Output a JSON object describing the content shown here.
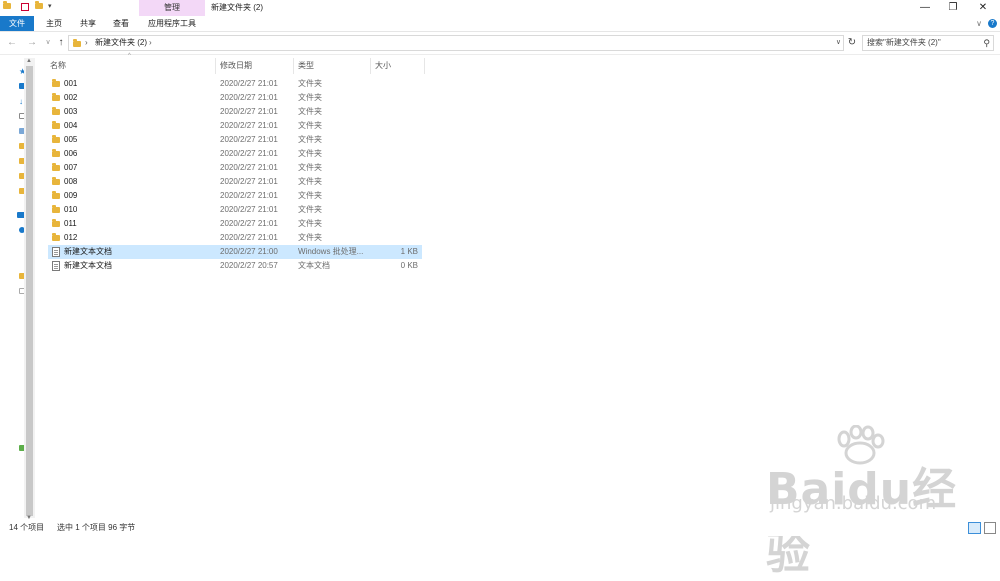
{
  "titlebar": {
    "manage_tab": "管理",
    "window_title": "新建文件夹 (2)",
    "minimize": "—",
    "maximize": "❐",
    "close": "✕"
  },
  "ribbon": {
    "tabs": [
      "文件",
      "主页",
      "共享",
      "查看",
      "应用程序工具"
    ],
    "collapse_glyph": "∨",
    "help_glyph": "?"
  },
  "address": {
    "path": "新建文件夹 (2)",
    "search_placeholder": "搜索\"新建文件夹 (2)\""
  },
  "columns": {
    "name": "名称",
    "date": "修改日期",
    "type": "类型",
    "size": "大小"
  },
  "files": [
    {
      "name": "001",
      "date": "2020/2/27 21:01",
      "type": "文件夹",
      "size": "",
      "kind": "folder"
    },
    {
      "name": "002",
      "date": "2020/2/27 21:01",
      "type": "文件夹",
      "size": "",
      "kind": "folder"
    },
    {
      "name": "003",
      "date": "2020/2/27 21:01",
      "type": "文件夹",
      "size": "",
      "kind": "folder"
    },
    {
      "name": "004",
      "date": "2020/2/27 21:01",
      "type": "文件夹",
      "size": "",
      "kind": "folder"
    },
    {
      "name": "005",
      "date": "2020/2/27 21:01",
      "type": "文件夹",
      "size": "",
      "kind": "folder"
    },
    {
      "name": "006",
      "date": "2020/2/27 21:01",
      "type": "文件夹",
      "size": "",
      "kind": "folder"
    },
    {
      "name": "007",
      "date": "2020/2/27 21:01",
      "type": "文件夹",
      "size": "",
      "kind": "folder"
    },
    {
      "name": "008",
      "date": "2020/2/27 21:01",
      "type": "文件夹",
      "size": "",
      "kind": "folder"
    },
    {
      "name": "009",
      "date": "2020/2/27 21:01",
      "type": "文件夹",
      "size": "",
      "kind": "folder"
    },
    {
      "name": "010",
      "date": "2020/2/27 21:01",
      "type": "文件夹",
      "size": "",
      "kind": "folder"
    },
    {
      "name": "011",
      "date": "2020/2/27 21:01",
      "type": "文件夹",
      "size": "",
      "kind": "folder"
    },
    {
      "name": "012",
      "date": "2020/2/27 21:01",
      "type": "文件夹",
      "size": "",
      "kind": "folder"
    },
    {
      "name": "新建文本文档",
      "date": "2020/2/27 21:00",
      "type": "Windows 批处理...",
      "size": "1 KB",
      "kind": "batch",
      "selected": true
    },
    {
      "name": "新建文本文档",
      "date": "2020/2/27 20:57",
      "type": "文本文档",
      "size": "0 KB",
      "kind": "text"
    }
  ],
  "status": {
    "item_count": "14 个项目",
    "selection": "选中 1 个项目  96 字节"
  },
  "watermark": {
    "brand": "Baidu经验",
    "url": "jingyan.baidu.com"
  },
  "colors": {
    "file_tab": "#1979ca",
    "manage_tab": "#f3d8f7",
    "selection": "#cce8ff",
    "folder": "#e8b53b"
  }
}
